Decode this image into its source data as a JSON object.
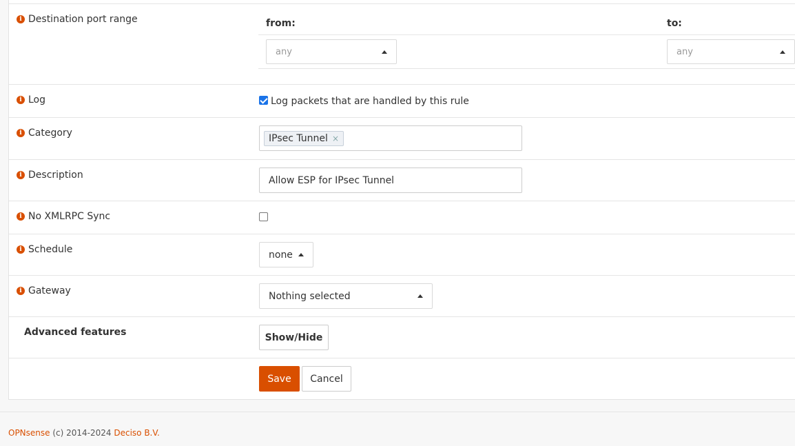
{
  "destination_port_range": {
    "label": "Destination port range",
    "from_label": "from:",
    "to_label": "to:",
    "from_value": "any",
    "to_value": "any"
  },
  "log": {
    "label": "Log",
    "checkbox_text": "Log packets that are handled by this rule",
    "checked": true
  },
  "category": {
    "label": "Category",
    "tags": [
      "IPsec Tunnel"
    ],
    "remove_glyph": "×"
  },
  "description": {
    "label": "Description",
    "value": "Allow ESP for IPsec Tunnel"
  },
  "no_xmlrpc_sync": {
    "label": "No XMLRPC Sync",
    "checked": false
  },
  "schedule": {
    "label": "Schedule",
    "value": "none"
  },
  "gateway": {
    "label": "Gateway",
    "value": "Nothing selected"
  },
  "advanced_features": {
    "label": "Advanced features",
    "button_label": "Show/Hide"
  },
  "actions": {
    "save_label": "Save",
    "cancel_label": "Cancel"
  },
  "footer": {
    "brand": "OPNsense",
    "copyright": " (c) 2014-2024 ",
    "company": "Deciso B.V."
  },
  "colors": {
    "accent": "#d94f00",
    "checkbox": "#1a73e8"
  },
  "icons": {
    "info": "info-icon",
    "caret": "caret-up-icon"
  }
}
